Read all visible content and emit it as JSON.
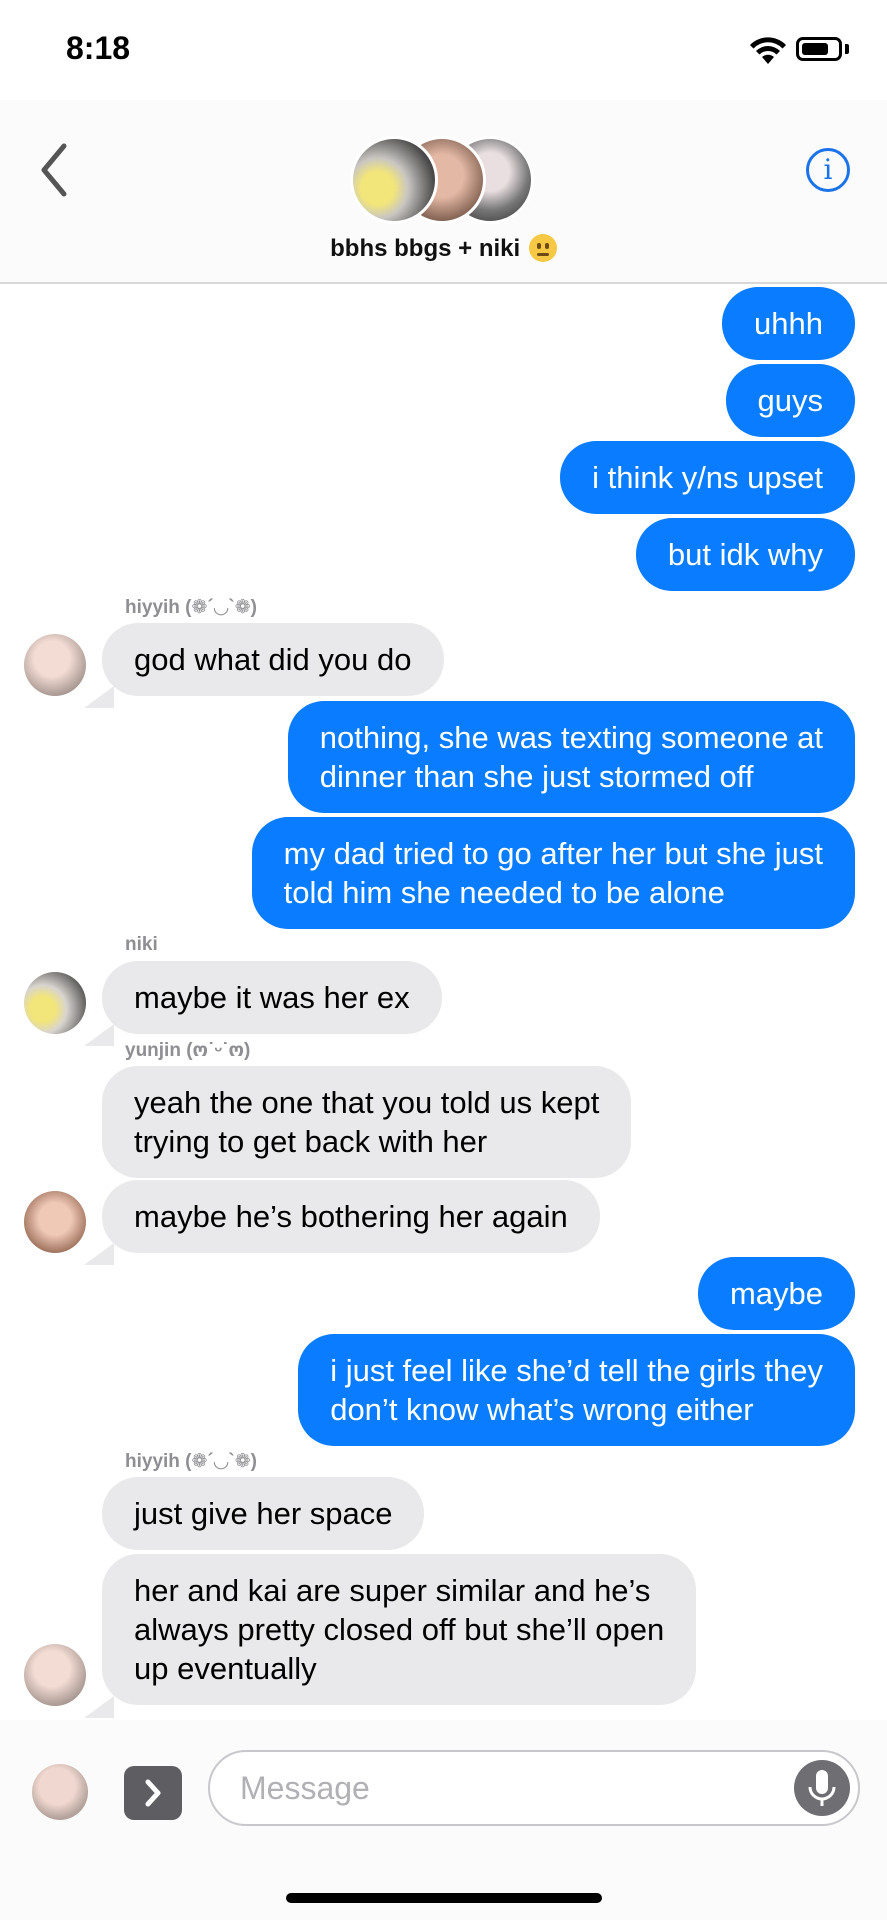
{
  "status_bar": {
    "time": "8:18",
    "battery_level": 0.75
  },
  "header": {
    "back_icon": "chevron-left-icon",
    "group_name": "bbhs bbgs + niki",
    "group_emoji": "neutral-face-emoji",
    "info_icon_glyph": "i"
  },
  "messages": [
    {
      "id": 1,
      "direction": "outgoing",
      "text": "uhhh"
    },
    {
      "id": 2,
      "direction": "outgoing",
      "text": "guys"
    },
    {
      "id": 3,
      "direction": "outgoing",
      "text": "i think y/ns upset"
    },
    {
      "id": 4,
      "direction": "outgoing",
      "text": "but idk why"
    },
    {
      "id": 5,
      "direction": "incoming",
      "sender": "hiyyih (❁´◡`❁)",
      "text": "god what did you do"
    },
    {
      "id": 6,
      "direction": "outgoing",
      "text": "nothing, she was texting someone at\ndinner than she just stormed off"
    },
    {
      "id": 7,
      "direction": "outgoing",
      "text": "my dad tried to go after her but she just\ntold him she needed to be alone"
    },
    {
      "id": 8,
      "direction": "incoming",
      "sender": "niki",
      "text": "maybe it was her ex"
    },
    {
      "id": 9,
      "direction": "incoming",
      "sender": "yunjin  (ო˙ᵕ˙ო)",
      "text": "yeah the one that you told us kept\ntrying to get back with her"
    },
    {
      "id": 10,
      "direction": "incoming",
      "text": "maybe he’s bothering her again"
    },
    {
      "id": 11,
      "direction": "outgoing",
      "text": "maybe"
    },
    {
      "id": 12,
      "direction": "outgoing",
      "text": "i just feel like she’d tell the girls they\ndon’t know what’s wrong either"
    },
    {
      "id": 13,
      "direction": "incoming",
      "sender": "hiyyih (❁´◡`❁)",
      "text": "just give her space"
    },
    {
      "id": 14,
      "direction": "incoming",
      "text": "her and kai are super similar and he’s\nalways pretty closed off but she’ll open\nup eventually"
    }
  ],
  "composer": {
    "placeholder": "Message",
    "expand_icon": "chevron-right-icon",
    "mic_icon": "microphone-icon"
  },
  "colors": {
    "outgoing_bubble": "#0a7cff",
    "incoming_bubble": "#e9e9eb",
    "accent": "#1a73e8"
  }
}
